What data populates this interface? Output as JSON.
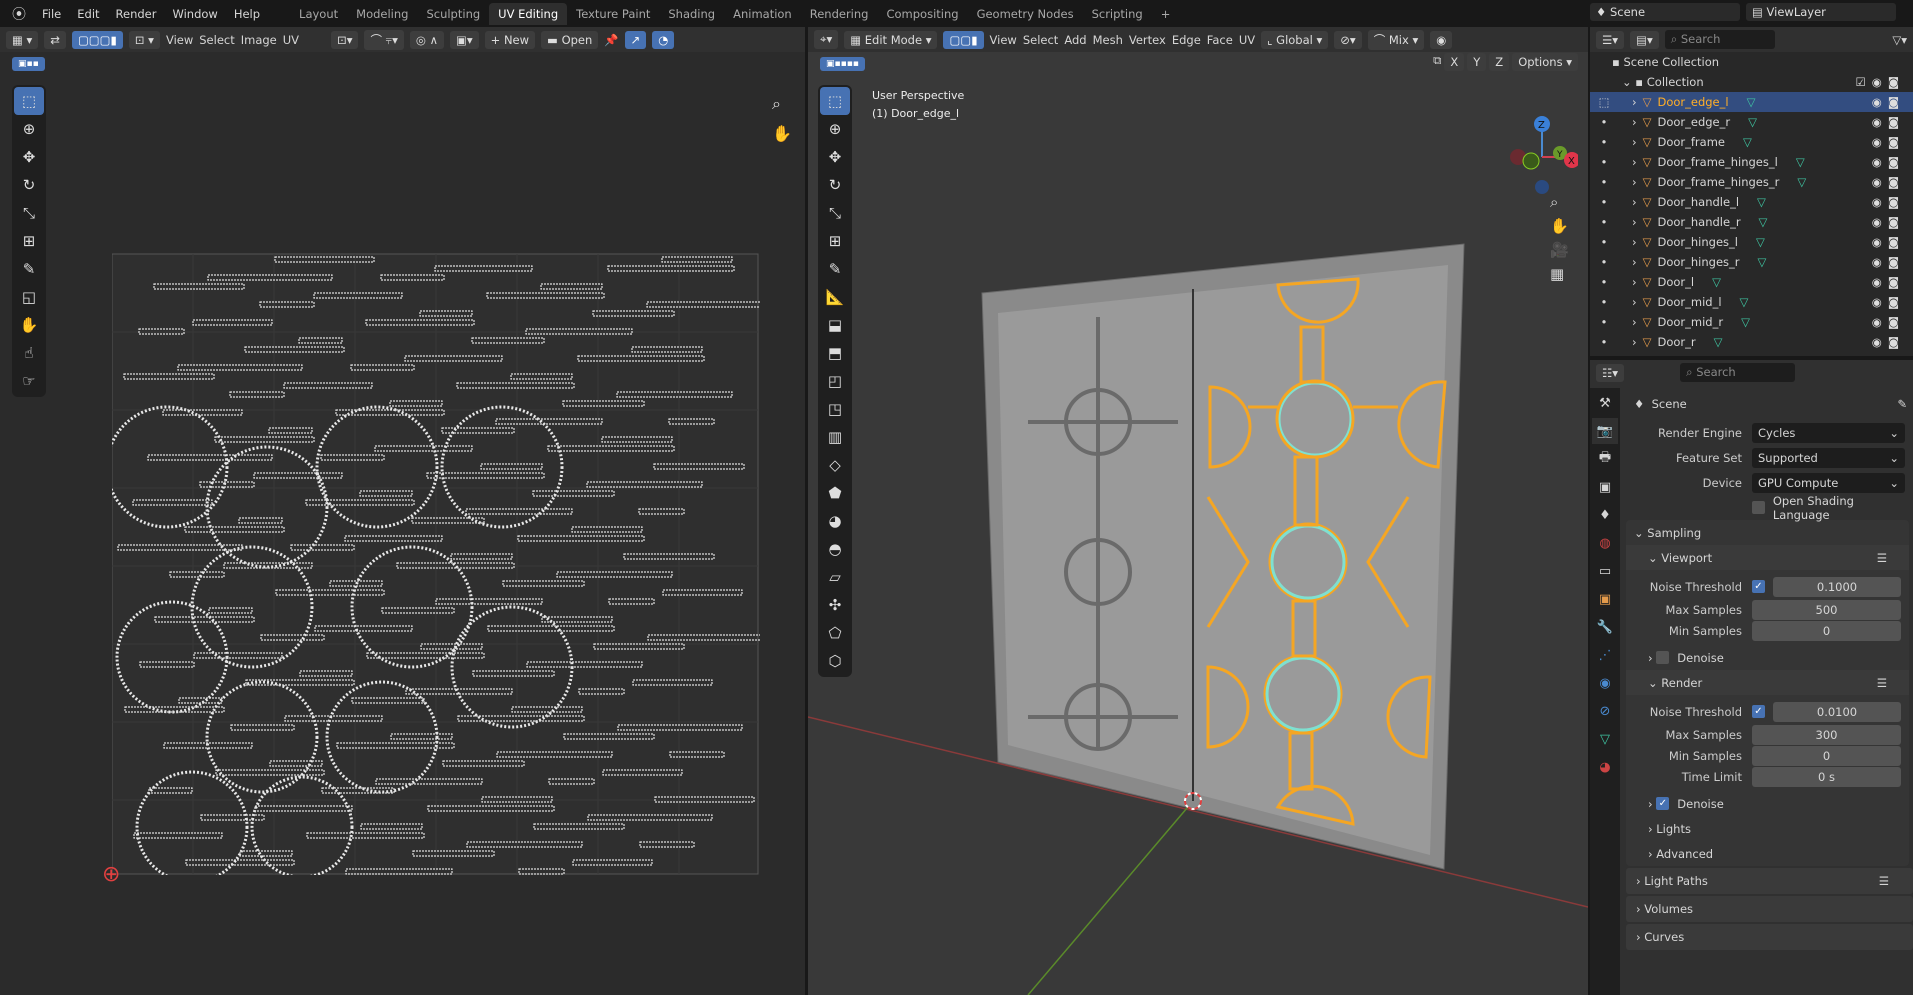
{
  "menu": [
    "File",
    "Edit",
    "Render",
    "Window",
    "Help"
  ],
  "workspaces": [
    "Layout",
    "Modeling",
    "Sculpting",
    "UV Editing",
    "Texture Paint",
    "Shading",
    "Animation",
    "Rendering",
    "Compositing",
    "Geometry Nodes",
    "Scripting"
  ],
  "active_workspace": "UV Editing",
  "scene_selector": "Scene",
  "view_layer": "ViewLayer",
  "uv_editor": {
    "menus": [
      "View",
      "Select",
      "Image",
      "UV"
    ],
    "new_label": "New",
    "open_label": "Open"
  },
  "viewport": {
    "mode": "Edit Mode",
    "menus": [
      "View",
      "Select",
      "Add",
      "Mesh",
      "Vertex",
      "Edge",
      "Face",
      "UV"
    ],
    "orientation": "Global",
    "snap": "Mix",
    "axes": [
      "X",
      "Y",
      "Z"
    ],
    "options_label": "Options",
    "overlay_title": "User Perspective",
    "overlay_object": "(1) Door_edge_l",
    "gizmo": [
      "Z",
      "Y",
      "X"
    ]
  },
  "outliner": {
    "search_placeholder": "Search",
    "scene_collection": "Scene Collection",
    "collection": "Collection",
    "objects": [
      "Door_edge_l",
      "Door_edge_r",
      "Door_frame",
      "Door_frame_hinges_l",
      "Door_frame_hinges_r",
      "Door_handle_l",
      "Door_handle_r",
      "Door_hinges_l",
      "Door_hinges_r",
      "Door_l",
      "Door_mid_l",
      "Door_mid_r",
      "Door_r"
    ],
    "selected": "Door_edge_l"
  },
  "properties": {
    "search_placeholder": "Search",
    "context": "Scene",
    "render_engine": {
      "label": "Render Engine",
      "value": "Cycles"
    },
    "feature_set": {
      "label": "Feature Set",
      "value": "Supported"
    },
    "device": {
      "label": "Device",
      "value": "GPU Compute"
    },
    "osl": {
      "label": "Open Shading Language",
      "checked": false
    },
    "sampling": {
      "title": "Sampling",
      "viewport": {
        "title": "Viewport",
        "noise_threshold_label": "Noise Threshold",
        "noise_threshold": "0.1000",
        "max_samples_label": "Max Samples",
        "max_samples": "500",
        "min_samples_label": "Min Samples",
        "min_samples": "0",
        "denoise_label": "Denoise"
      },
      "render": {
        "title": "Render",
        "noise_threshold_label": "Noise Threshold",
        "noise_threshold": "0.0100",
        "max_samples_label": "Max Samples",
        "max_samples": "300",
        "min_samples_label": "Min Samples",
        "min_samples": "0",
        "time_limit_label": "Time Limit",
        "time_limit": "0 s",
        "denoise_label": "Denoise"
      },
      "lights": "Lights",
      "advanced": "Advanced"
    },
    "panels": [
      "Light Paths",
      "Volumes",
      "Curves"
    ]
  },
  "colors": {
    "accent": "#4772b3",
    "selected_edge": "#f5a623",
    "mesh_icon": "#3fc5a2"
  }
}
